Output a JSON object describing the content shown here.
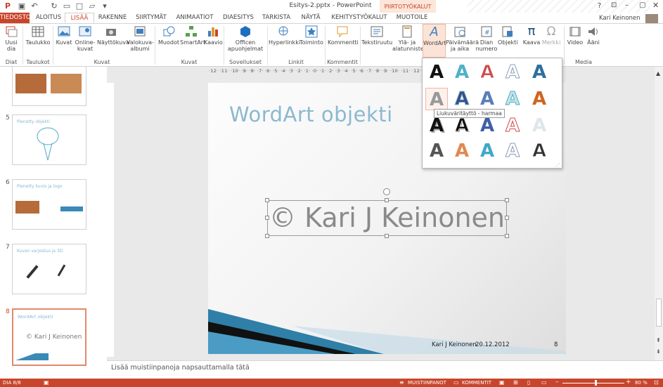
{
  "window": {
    "title": "Esitys-2.pptx - PowerPoint",
    "user": "Kari Keinonen",
    "help": "?",
    "context_group": "PIIRTOTYÖKALUT"
  },
  "tabs": [
    "TIEDOSTO",
    "ALOITUS",
    "LISÄÄ",
    "RAKENNE",
    "SIIRTYMÄT",
    "ANIMAATIOT",
    "DIAESITYS",
    "TARKISTA",
    "NÄYTÄ",
    "KEHITYSTYÖKALUT",
    "MUOTOILE"
  ],
  "ribbon": {
    "buttons": [
      {
        "label": "Uusi\ndia",
        "name": "new-slide-button",
        "icon": "new-slide-icon"
      },
      {
        "label": "Taulukko",
        "name": "table-button",
        "icon": "table-icon"
      },
      {
        "label": "Kuvat",
        "name": "pictures-button",
        "icon": "pictures-icon"
      },
      {
        "label": "Online-\nkuvat",
        "name": "online-pictures-button",
        "icon": "online-pictures-icon"
      },
      {
        "label": "Näyttökuva",
        "name": "screenshot-button",
        "icon": "camera-icon"
      },
      {
        "label": "Valokuva-\nalbumi",
        "name": "photo-album-button",
        "icon": "photo-album-icon"
      },
      {
        "label": "Muodot",
        "name": "shapes-button",
        "icon": "shapes-icon"
      },
      {
        "label": "SmartArt",
        "name": "smartart-button",
        "icon": "smartart-icon"
      },
      {
        "label": "Kaavio",
        "name": "chart-button",
        "icon": "chart-icon"
      },
      {
        "label": "Officen\napuohjelmat",
        "name": "office-apps-button",
        "icon": "office-apps-icon"
      },
      {
        "label": "Hyperlinkki",
        "name": "hyperlink-button",
        "icon": "globe-link-icon"
      },
      {
        "label": "Toiminto",
        "name": "action-button",
        "icon": "star-icon"
      },
      {
        "label": "Kommentti",
        "name": "comment-button",
        "icon": "comment-icon"
      },
      {
        "label": "Tekstiruutu",
        "name": "textbox-button",
        "icon": "textbox-icon"
      },
      {
        "label": "Ylä- ja\nalatunniste",
        "name": "header-footer-button",
        "icon": "header-footer-icon"
      },
      {
        "label": "WordArt",
        "name": "wordart-button",
        "icon": "wordart-icon"
      },
      {
        "label": "Päivämäärä\nja aika",
        "name": "date-time-button",
        "icon": "calendar-icon"
      },
      {
        "label": "Dian\nnumero",
        "name": "slide-number-button",
        "icon": "slide-number-icon"
      },
      {
        "label": "Objekti",
        "name": "object-button",
        "icon": "object-icon"
      },
      {
        "label": "Kaava",
        "name": "equation-button",
        "icon": "pi-icon"
      },
      {
        "label": "Merkki",
        "name": "symbol-button",
        "icon": "omega-icon"
      },
      {
        "label": "Video",
        "name": "video-button",
        "icon": "video-icon"
      },
      {
        "label": "Ääni",
        "name": "audio-button",
        "icon": "speaker-icon"
      }
    ],
    "groups": [
      "Diat",
      "Taulukot",
      "Kuvat",
      "Kuvat",
      "Sovellukset",
      "Linkit",
      "Kommentit",
      "Media"
    ]
  },
  "ruler": {
    "horizontal": "·12· ·11· ·10· ·9· ·8· ·7· ·6· ·5· ·4· ·3· ·2· ·1· ·0· ·1· ·2· ·3· ·4· ·5· ·6· ·7· ·8· ·9· ·10· ·11· ·12·"
  },
  "thumbnails": [
    {
      "num": "",
      "title": ""
    },
    {
      "num": "5",
      "title": "Pienetty objekti"
    },
    {
      "num": "6",
      "title": "Pienetty kuvio ja logo"
    },
    {
      "num": "7",
      "title": "Kuvan varjostus ja 3D"
    },
    {
      "num": "8",
      "title": "WordArt objekti",
      "body": "© Kari J Keinonen"
    }
  ],
  "slide": {
    "title": "WordArt objekti",
    "wordart": "© Kari J Keinonen",
    "footer_name": "Kari J Keinonen",
    "footer_date": "20.12.2012",
    "footer_num": "8"
  },
  "gallery": {
    "tooltip": "Liukuväritäyttö - harmaa"
  },
  "notes": {
    "placeholder": "Lisää muistiinpanoja napsauttamalla tätä"
  },
  "status": {
    "slide": "DIA 8/8",
    "notes": "MUISTIINPANOT",
    "comments": "KOMMENTIT",
    "zoom": "80 %"
  },
  "colors": {
    "accent": "#c8452b",
    "title": "#8cb8d0",
    "wordart": "#8a8a8a"
  }
}
